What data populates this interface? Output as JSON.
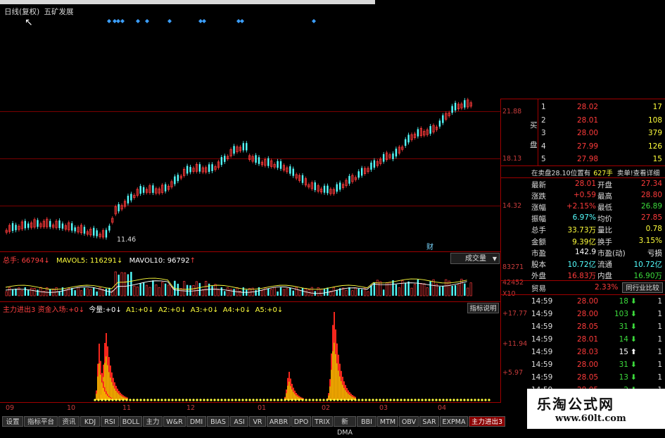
{
  "header": {
    "period": "日线(复权)",
    "stock_name": "五矿发展"
  },
  "price_axis": [
    "21.88",
    "18.13",
    "14.32"
  ],
  "low_marker": "11.46",
  "cai_marker": "财",
  "volume_panel": {
    "label": "总手:",
    "value": "66794",
    "mavol5_label": "MAVOL5:",
    "mavol5": "116291",
    "mavol10_label": "MAVOL10:",
    "mavol10": "96792",
    "dropdown": "成交量",
    "axis": [
      "83271",
      "42452",
      "X10"
    ]
  },
  "indicator_panel": {
    "label": "主力进出3",
    "fund_label": "资金入场:",
    "fund_value": "+0",
    "vol_label": "今量:",
    "vol_value": "+0",
    "a1_label": "A1:",
    "a1_value": "+0",
    "a2_label": "A2:",
    "a2_value": "+0",
    "a3_label": "A3:",
    "a3_value": "+0",
    "a4_label": "A4:",
    "a4_value": "+0",
    "a5_label": "A5:",
    "a5_value": "+0",
    "help_button": "指标说明",
    "axis": [
      "+17.77",
      "+11.94",
      "+5.97"
    ]
  },
  "x_axis": [
    "09",
    "10",
    "11",
    "12",
    "01",
    "02",
    "03",
    "04"
  ],
  "tabs": [
    "设置",
    "指标平台",
    "资讯",
    "KDJ",
    "RSI",
    "BOLL",
    "主力",
    "W&R",
    "DMI",
    "BIAS",
    "ASI",
    "VR",
    "ARBR",
    "DPO",
    "TRIX",
    "新DMA",
    "BBI",
    "MTM",
    "OBV",
    "SAR",
    "EXPMA",
    "主力进出3"
  ],
  "order_book": {
    "side_label_1": "买",
    "side_label_2": "盘",
    "rows": [
      {
        "level": "1",
        "price": "28.02",
        "volume": "17"
      },
      {
        "level": "2",
        "price": "28.01",
        "volume": "108"
      },
      {
        "level": "3",
        "price": "28.00",
        "volume": "379"
      },
      {
        "level": "4",
        "price": "27.99",
        "volume": "126"
      },
      {
        "level": "5",
        "price": "27.98",
        "volume": "15"
      }
    ]
  },
  "notice": {
    "text": "在卖盘28.10位置有",
    "amount": "627手",
    "link": "卖单!查看详细"
  },
  "quote": [
    {
      "l1": "最新",
      "v1": "28.01",
      "l2": "开盘",
      "v2": "27.34"
    },
    {
      "l1": "涨跌",
      "v1": "+0.59",
      "l2": "最高",
      "v2": "28.80"
    },
    {
      "l1": "涨幅",
      "v1": "+2.15%",
      "l2": "最低",
      "v2": "26.89"
    },
    {
      "l1": "振幅",
      "v1": "6.97%",
      "l2": "均价",
      "v2": "27.85"
    },
    {
      "l1": "总手",
      "v1": "33.73万",
      "l2": "量比",
      "v2": "0.78"
    },
    {
      "l1": "金额",
      "v1": "9.39亿",
      "l2": "换手",
      "v2": "3.15%"
    },
    {
      "l1": "市盈",
      "v1": "142.9",
      "l2": "市盈(动)",
      "v2": "亏损"
    },
    {
      "l1": "股本",
      "v1": "10.72亿",
      "l2": "流通",
      "v2": "10.72亿"
    },
    {
      "l1": "外盘",
      "v1": "16.83万",
      "l2": "内盘",
      "v2": "16.90万"
    }
  ],
  "industry": {
    "label": "贸易",
    "value": "2.33%",
    "button": "同行业比较"
  },
  "ticks": [
    {
      "time": "14:59",
      "price": "28.00",
      "vol": "18",
      "dir": "down",
      "n": "1"
    },
    {
      "time": "14:59",
      "price": "28.00",
      "vol": "103",
      "dir": "down",
      "n": "1"
    },
    {
      "time": "14:59",
      "price": "28.05",
      "vol": "31",
      "dir": "down",
      "n": "1"
    },
    {
      "time": "14:59",
      "price": "28.01",
      "vol": "14",
      "dir": "down",
      "n": "1"
    },
    {
      "time": "14:59",
      "price": "28.03",
      "vol": "15",
      "dir": "up",
      "n": "1"
    },
    {
      "time": "14:59",
      "price": "28.00",
      "vol": "31",
      "dir": "down",
      "n": "1"
    },
    {
      "time": "14:59",
      "price": "28.05",
      "vol": "13",
      "dir": "down",
      "n": "1"
    },
    {
      "time": "14:59",
      "price": "28.05",
      "vol": "2",
      "dir": "down",
      "n": "1"
    }
  ],
  "watermark": {
    "title": "乐淘公式网",
    "url": "www.60lt.com"
  },
  "colors": {
    "up": "#ff3b3b",
    "down": "#54ffff",
    "yellow": "#ffff3c",
    "grid": "#7a0000",
    "green_arrow": "#3cdc3c"
  }
}
